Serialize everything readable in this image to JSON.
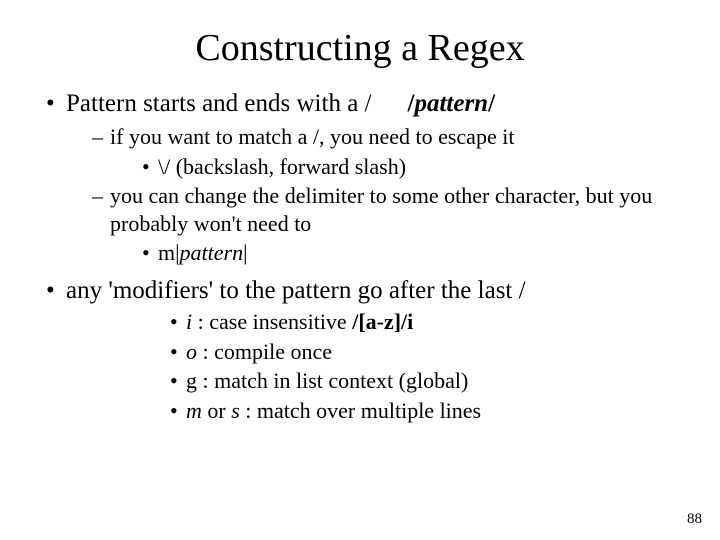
{
  "title": "Constructing a Regex",
  "b1": {
    "text_a": "Pattern starts and ends with a /",
    "text_b_bold": "/",
    "text_b_ital": "pattern",
    "text_b_bold2": "/",
    "sub": {
      "s1": "if you want to match a /, you need to escape it",
      "s1a": "\\/  (backslash, forward slash)",
      "s2": "you can change the delimiter to some other character, but you probably won't need to",
      "s2a_pre": "m|",
      "s2a_it": "pattern",
      "s2a_post": "|"
    }
  },
  "b2": {
    "text": "any 'modifiers' to the pattern go after the last /",
    "mods": {
      "m1_it": "i",
      "m1_rest": "   :  case insensitive  ",
      "m1_bold": "/[a-z]/i",
      "m2_it": "o",
      "m2_rest": "  :  compile once",
      "m3": "g  :  match in list context (global)",
      "m4_it": "m ",
      "m4_mid": "or ",
      "m4_it2": "s",
      "m4_rest": "  :  match over multiple lines"
    }
  },
  "pagenum": "88"
}
